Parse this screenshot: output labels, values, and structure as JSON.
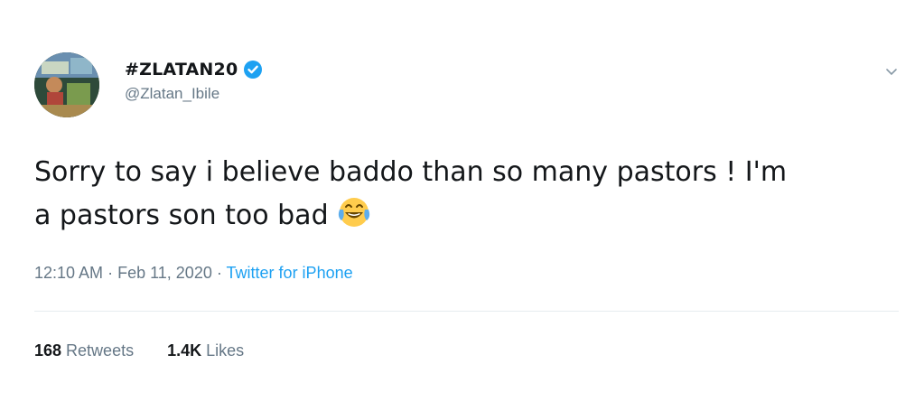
{
  "author": {
    "display_name": "#ZLATAN20",
    "handle": "@Zlatan_Ibile",
    "verified": true
  },
  "tweet": {
    "text_line1": "Sorry to say i believe baddo than so many pastors ! I'm",
    "text_line2": "a pastors son too bad",
    "emoji": "face-with-tears-of-joy"
  },
  "meta": {
    "time": "12:10 AM",
    "date": "Feb 11, 2020",
    "separator": "·",
    "source": "Twitter for iPhone"
  },
  "stats": {
    "retweets_count": "168",
    "retweets_label": "Retweets",
    "likes_count": "1.4K",
    "likes_label": "Likes"
  },
  "colors": {
    "accent": "#1da1f2",
    "text": "#14171a",
    "muted": "#657786",
    "divider": "#e6ecf0"
  },
  "icons": {
    "verified": "verified-badge-icon",
    "caret": "chevron-down-icon"
  }
}
